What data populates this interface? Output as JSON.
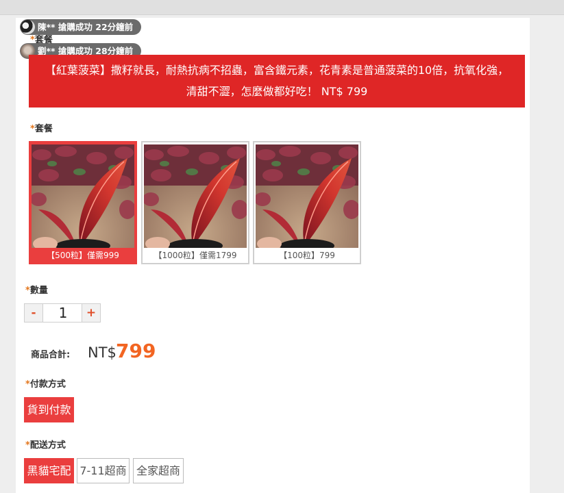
{
  "notifications": [
    {
      "text": "陳** 搶購成功 22分鐘前",
      "avatar": "user-avatar-panda"
    },
    {
      "text": "劉** 搶購成功 28分鐘前",
      "avatar": "user-avatar-person"
    }
  ],
  "ghost_label": "套餐",
  "banner": {
    "line1": "【紅葉菠菜】撒籽就長，耐熱抗病不招蟲，富含鐵元素，花青素是普通菠菜的10倍，抗氧化強，",
    "line2": "清甜不澀，怎麼做都好吃！ NT$ 799"
  },
  "package": {
    "required_mark": "*",
    "label": "套餐",
    "options": [
      {
        "caption": "【500粒】僅需999",
        "selected": true
      },
      {
        "caption": "【1000粒】僅需1799",
        "selected": false
      },
      {
        "caption": "【100粒】799",
        "selected": false
      }
    ]
  },
  "quantity": {
    "required_mark": "*",
    "label": "數量",
    "minus": "-",
    "value": "1",
    "plus": "+"
  },
  "total": {
    "label": "商品合計:",
    "currency": "NT$",
    "amount": "799"
  },
  "payment": {
    "required_mark": "*",
    "label": "付款方式",
    "options": [
      {
        "label": "貨到付款",
        "selected": true
      }
    ]
  },
  "shipping": {
    "required_mark": "*",
    "label": "配送方式",
    "options": [
      {
        "label": "黑貓宅配",
        "selected": true
      },
      {
        "label": "7-11超商",
        "selected": false
      },
      {
        "label": "全家超商",
        "selected": false
      }
    ]
  },
  "colors": {
    "accent_red": "#df2626",
    "selected_red": "#ea3e3e",
    "price_orange": "#f26522",
    "required_mark": "#e3761d"
  }
}
